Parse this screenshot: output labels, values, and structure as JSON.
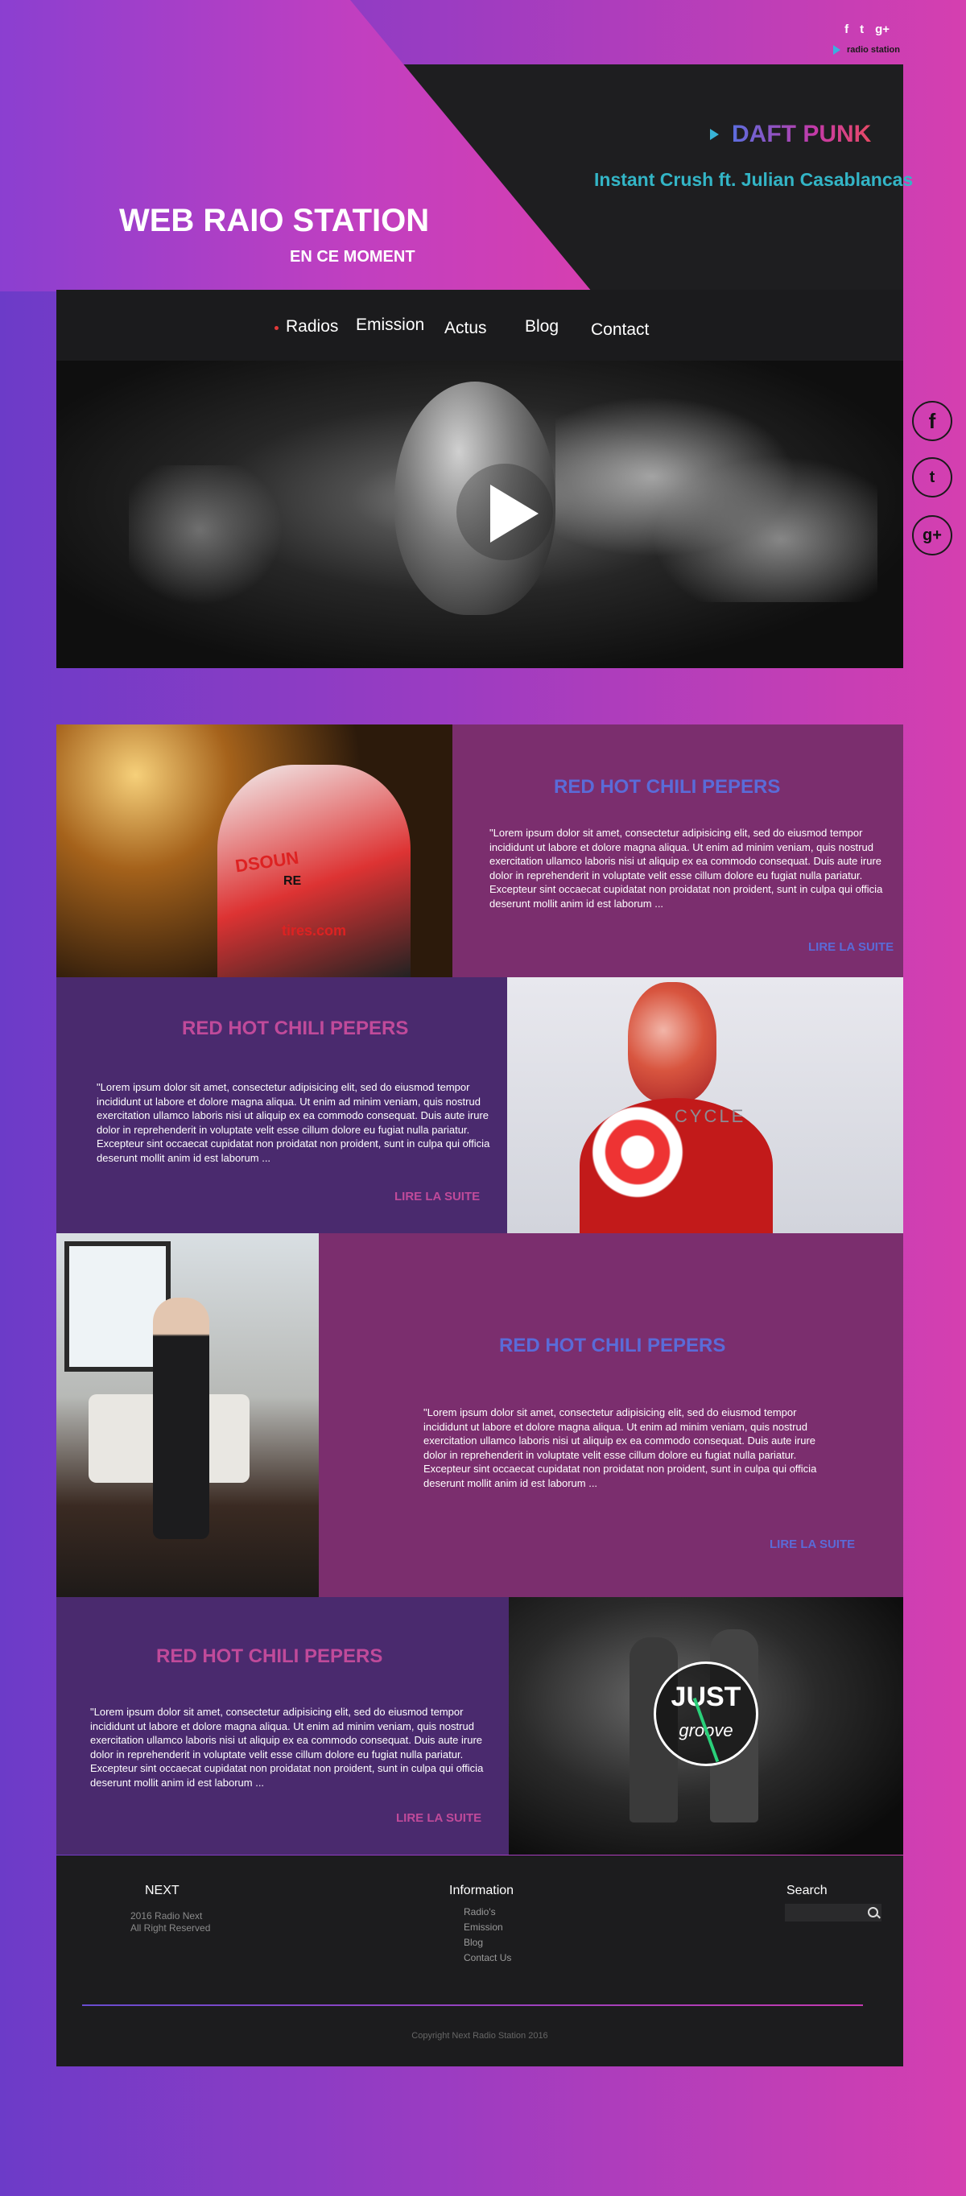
{
  "colors": {
    "accent_blue": "#5a6bd8",
    "accent_pink": "#c04a9a",
    "teal": "#33b5c6",
    "card_purple": "#7b2e6e",
    "card_violet": "#4a2a6e"
  },
  "top_bar": {
    "icons": [
      "facebook-icon",
      "twitter-icon",
      "google-plus-icon"
    ],
    "icon_glyphs": [
      "f",
      "t",
      "g+"
    ],
    "station_label": "radio station"
  },
  "header": {
    "title": "WEB RAIO STATION",
    "subtitle": "EN CE MOMENT",
    "artist": "DAFT PUNK",
    "track": "Instant Crush ft. Julian Casablancas"
  },
  "nav": {
    "items": [
      "Radios",
      "Emission",
      "Actus",
      "Blog",
      "Contact"
    ]
  },
  "side_social": {
    "glyphs": [
      "f",
      "t",
      "g+"
    ]
  },
  "cards": [
    {
      "title": "RED  HOT CHILI PEPERS",
      "text": "\"Lorem ipsum dolor sit amet, consectetur adipisicing elit, sed do eiusmod tempor incididunt ut labore et dolore magna aliqua. Ut enim ad minim veniam, quis nostrud exercitation ullamco laboris nisi ut aliquip ex ea commodo consequat. Duis aute irure dolor in reprehenderit in voluptate velit esse cillum dolore eu fugiat nulla pariatur. Excepteur sint occaecat cupidatat non proidatat non proident, sunt in culpa qui officia deserunt mollit anim id est laborum ...",
      "more": "LIRE LA SUITE"
    },
    {
      "title": "RED  HOT CHILI PEPERS",
      "text": "\"Lorem ipsum dolor sit amet, consectetur adipisicing elit, sed do eiusmod tempor incididunt ut labore et dolore magna aliqua. Ut enim ad minim veniam, quis nostrud exercitation ullamco laboris nisi ut aliquip ex ea commodo consequat. Duis aute irure dolor in reprehenderit in voluptate velit esse cillum dolore eu fugiat nulla pariatur. Excepteur sint occaecat cupidatat non proidatat non proident, sunt in culpa qui officia deserunt mollit anim id est laborum ...",
      "more": "LIRE LA SUITE",
      "image_text": "CYCLE"
    },
    {
      "title": "RED  HOT CHILI PEPERS",
      "text": "\"Lorem ipsum dolor sit amet, consectetur adipisicing elit, sed do eiusmod tempor incididunt ut labore et dolore magna aliqua. Ut enim ad minim veniam, quis nostrud exercitation ullamco laboris nisi ut aliquip ex ea commodo consequat. Duis aute irure dolor in reprehenderit in voluptate velit esse cillum dolore eu fugiat nulla pariatur. Excepteur sint occaecat cupidatat non proidatat non proident, sunt in culpa qui officia deserunt mollit anim id est laborum ...",
      "more": "LIRE LA SUITE"
    },
    {
      "title": "RED  HOT CHILI PEPERS",
      "text": "\"Lorem ipsum dolor sit amet, consectetur adipisicing elit, sed do eiusmod tempor incididunt ut labore et dolore magna aliqua. Ut enim ad minim veniam, quis nostrud exercitation ullamco laboris nisi ut aliquip ex ea commodo consequat. Duis aute irure dolor in reprehenderit in voluptate velit esse cillum dolore eu fugiat nulla pariatur. Excepteur sint occaecat cupidatat non proidatat non proident, sunt in culpa qui officia deserunt mollit anim id est laborum ...",
      "more": "LIRE LA SUITE",
      "logo_top": "JUST",
      "logo_bottom": "groove"
    }
  ],
  "card1_image_text": {
    "line1": "DSOUN",
    "line2": "RE",
    "line3": "tires.com"
  },
  "footer": {
    "col1": {
      "title": "NEXT",
      "line1": "2016 Radio Next",
      "line2": "All Right Reserved"
    },
    "col2": {
      "title": "Information",
      "links": [
        "Radio's",
        "Emission",
        "Blog",
        "Contact Us"
      ]
    },
    "col3": {
      "title": "Search"
    },
    "copyright": "Copyright Next Radio Station 2016"
  }
}
